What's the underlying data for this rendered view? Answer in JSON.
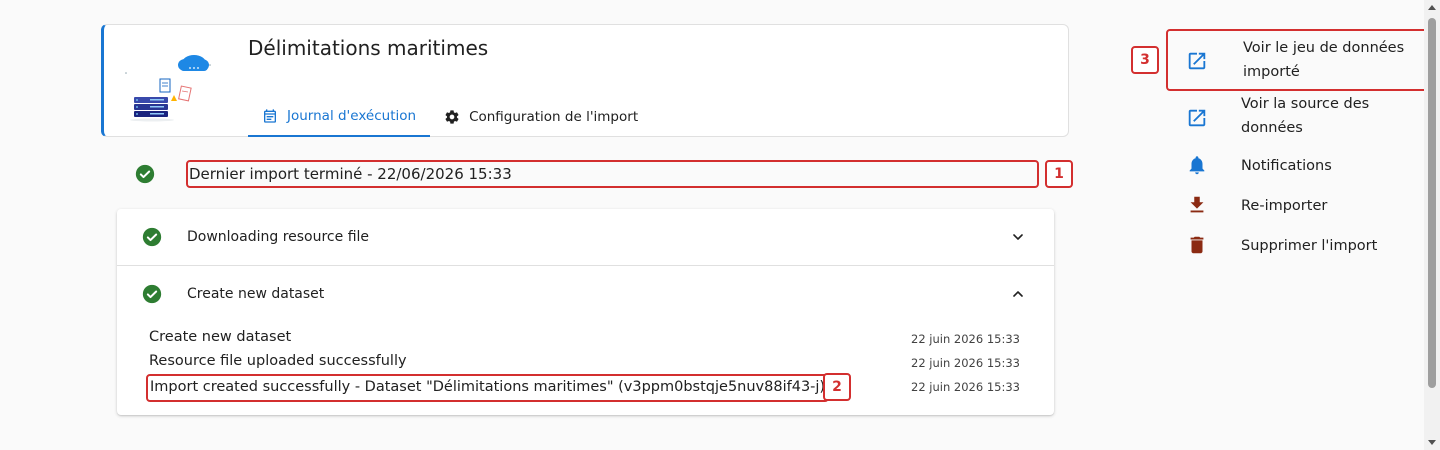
{
  "header": {
    "title": "Délimitations maritimes",
    "tabs": [
      {
        "label": "Journal d'exécution",
        "icon": "calendar-icon",
        "active": true
      },
      {
        "label": "Configuration de l'import",
        "icon": "gear-icon",
        "active": false
      }
    ]
  },
  "status": {
    "text": "Dernier import terminé - 22/06/2026 15:33",
    "marker": "1"
  },
  "steps": [
    {
      "label": "Downloading resource file",
      "expanded": false
    },
    {
      "label": "Create new dataset",
      "expanded": true
    }
  ],
  "log": [
    {
      "message": "Create new dataset",
      "date": "22 juin 2026 15:33"
    },
    {
      "message": "Resource file uploaded successfully",
      "date": "22 juin 2026 15:33"
    },
    {
      "message": "Import created successfully - Dataset \"Délimitations maritimes\" (v3ppm0bstqje5nuv88if43-j)",
      "date": "22 juin 2026 15:33"
    }
  ],
  "log_marker": "2",
  "actions": {
    "marker": "3",
    "items": [
      {
        "line1": "Voir le jeu de données",
        "line2": "importé",
        "icon": "open-external-icon"
      },
      {
        "line1": "Voir la source des",
        "line2": "données",
        "icon": "open-external-icon"
      },
      {
        "line1": "Notifications",
        "icon": "bell-icon"
      },
      {
        "line1": "Re-importer",
        "icon": "download-icon"
      },
      {
        "line1": "Supprimer l'import",
        "icon": "trash-icon"
      }
    ]
  },
  "colors": {
    "primary": "#1976d2",
    "success": "#2e7d32",
    "annotation": "#d32f2f",
    "danger": "#8b2a12"
  }
}
